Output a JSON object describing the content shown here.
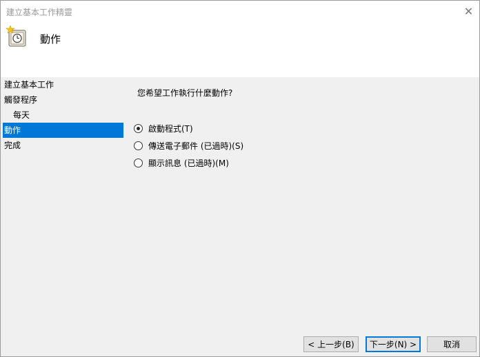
{
  "window": {
    "title": "建立基本工作精靈",
    "close_glyph": "✕"
  },
  "header": {
    "title": "動作",
    "icon": "clock-icon"
  },
  "nav": {
    "items": [
      {
        "label": "建立基本工作"
      },
      {
        "label": "觸發程序"
      },
      {
        "label": "每天"
      },
      {
        "label": "動作"
      },
      {
        "label": "完成"
      }
    ],
    "selected": "動作"
  },
  "main": {
    "prompt": "您希望工作執行什麼動作?",
    "options": [
      {
        "label": "啟動程式(T)",
        "checked": true
      },
      {
        "label": "傳送電子郵件 (已過時)(S)",
        "checked": false
      },
      {
        "label": "顯示訊息 (已過時)(M)",
        "checked": false
      }
    ]
  },
  "buttons": {
    "back": "< 上一步(B)",
    "next": "下一步(N) >",
    "cancel": "取消"
  },
  "colors": {
    "accent": "#0078d7",
    "window_bg": "#f0f0f0",
    "header_bg": "#ffffff"
  }
}
